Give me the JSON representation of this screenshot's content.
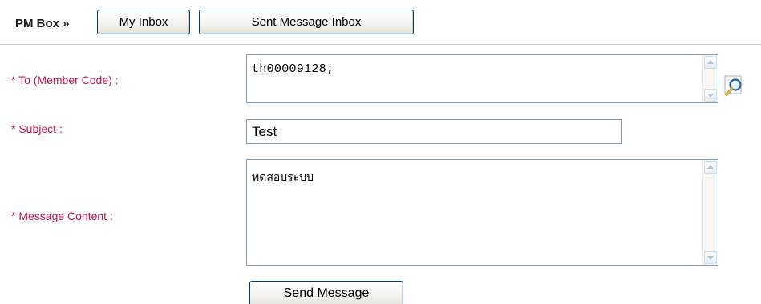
{
  "header": {
    "title": "PM Box »",
    "my_inbox_label": "My Inbox",
    "sent_inbox_label": "Sent Message Inbox"
  },
  "form": {
    "to_label": "* To (Member Code) :",
    "to_value": "th00009128;",
    "subject_label": "* Subject :",
    "subject_value": "Test",
    "content_label": "* Message Content :",
    "content_value": "ทดสอบระบบ",
    "send_label": "Send Message"
  },
  "icons": {
    "member_lookup": "magnifier-icon"
  },
  "colors": {
    "label": "#c4124c",
    "button_border": "#003c74",
    "field_border": "#7f9db9"
  }
}
